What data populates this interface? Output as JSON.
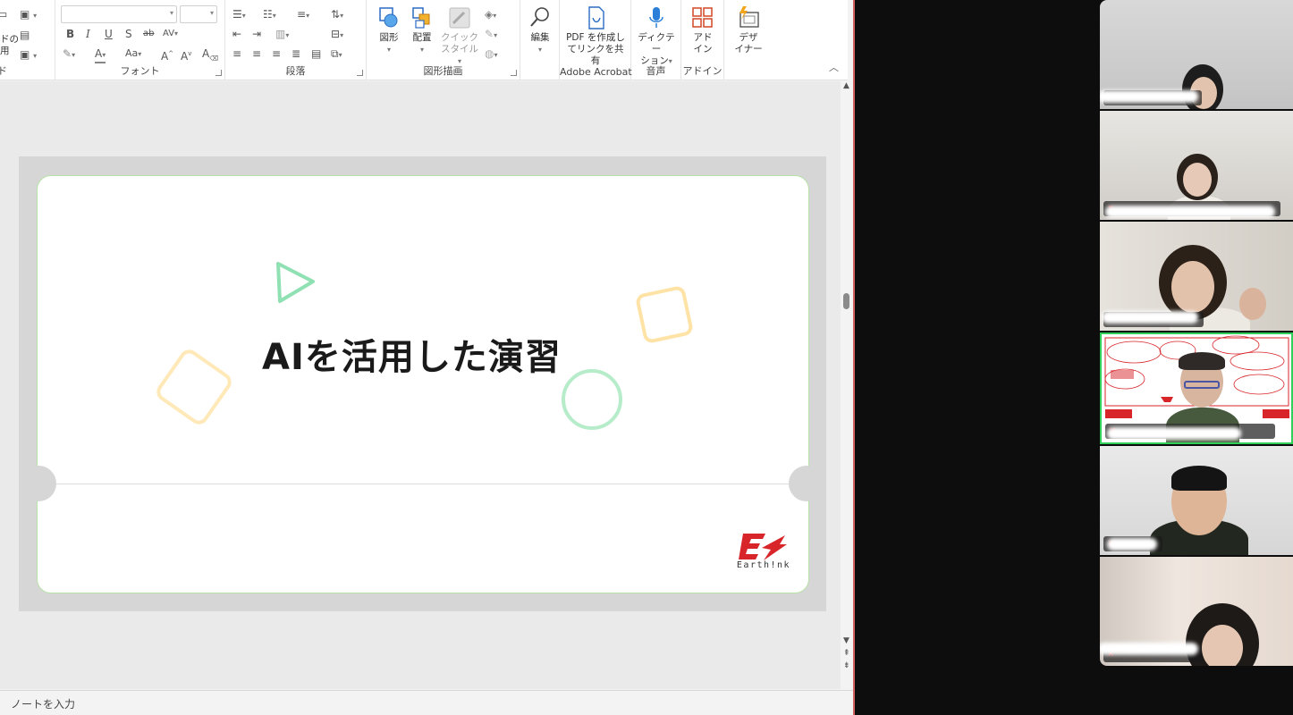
{
  "ribbon": {
    "groups": {
      "slides_partial": "ド",
      "font": "フォント",
      "paragraph": "段落",
      "drawing": "図形描画",
      "acrobat": "Adobe Acrobat",
      "voice": "音声",
      "addins": "アドイン"
    },
    "slides_partial_text": {
      "line1": "ドの",
      "line2": "用"
    },
    "buttons": {
      "shapes": "図形",
      "arrange": "配置",
      "quick_style_1": "クイック",
      "quick_style_2": "スタイル",
      "edit": "編集",
      "pdf_1": "PDF を作成し",
      "pdf_2": "てリンクを共有",
      "dictate_1": "ディクテー",
      "dictate_2": "ション",
      "addin_1": "アド",
      "addin_2": "イン",
      "designer_1": "デザ",
      "designer_2": "イナー"
    },
    "font_buttons": {
      "bold": "B",
      "italic": "I",
      "underline": "U",
      "shadow": "S",
      "strike": "ab",
      "spacing": "AV",
      "font_color": "A",
      "case": "Aa",
      "grow": "A",
      "shrink": "A",
      "clear": "A"
    }
  },
  "slide": {
    "title": "AIを活用した演習",
    "logo_text": "Earth!nk"
  },
  "notes": {
    "placeholder": "ノートを入力"
  },
  "gallery": {
    "tiles": [
      {
        "id": 1
      },
      {
        "id": 2
      },
      {
        "id": 3
      },
      {
        "id": 4,
        "active": true
      },
      {
        "id": 5
      },
      {
        "id": 6
      }
    ],
    "active_border_color": "#2fd15a"
  },
  "colors": {
    "accent_green": "#8fe0b2",
    "accent_yellow": "#ffe3a6",
    "brand_red": "#d8252a",
    "window_border": "#d06060"
  }
}
